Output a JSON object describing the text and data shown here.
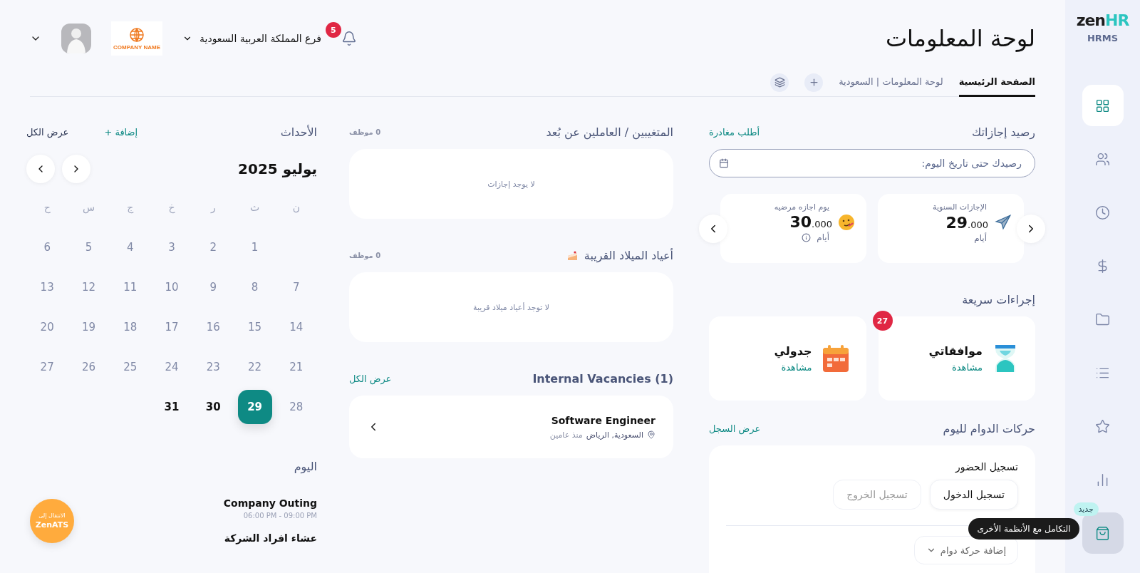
{
  "sidebar": {
    "brand": {
      "part_1": "zen",
      "part_2": "HR",
      "subtitle": "HRMS"
    },
    "items": [
      {
        "selected": true,
        "hovered": false
      },
      {
        "selected": false,
        "hovered": false
      },
      {
        "selected": false,
        "hovered": false
      },
      {
        "selected": false,
        "hovered": false
      },
      {
        "selected": false,
        "hovered": false
      },
      {
        "selected": false,
        "hovered": false
      },
      {
        "selected": false,
        "hovered": false
      },
      {
        "selected": false,
        "hovered": false
      },
      {
        "selected": false,
        "hovered": true,
        "badge": "جديد",
        "tooltip": "التكامل مع الأنظمة الأخرى"
      }
    ]
  },
  "header": {
    "title": "لوحة المعلومات",
    "notifications": "5",
    "branch": "فرع المملكة العربية السعودية",
    "company_logo_text": "COMPANY NAME"
  },
  "tabs": [
    {
      "label": "الصفحة الرئيسية",
      "selected": true
    },
    {
      "label": "لوحة المعلومات | السعودية",
      "selected": false
    }
  ],
  "leave_balance": {
    "title": "رصيد إجازاتك",
    "action": "أطلب مغادرة",
    "date_field": {
      "placeholder": "رصيدك حتى تاريخ اليوم:"
    },
    "cards": [
      {
        "label": "الإجازات السنوية",
        "value": "29.000",
        "unit": "أيام",
        "info": false
      },
      {
        "label": "يوم اجازه مرضيه",
        "value": "30.000",
        "unit": "أيام",
        "info": true
      }
    ]
  },
  "quick_actions": {
    "title": "إجراءات سريعة",
    "items": [
      {
        "title": "موافقاتي",
        "link": "مشاهدة",
        "badge": "27"
      },
      {
        "title": "جدولي",
        "link": "مشاهدة"
      }
    ]
  },
  "attendance": {
    "title": "حركات الدوام لليوم",
    "action": "عرض السجل",
    "heading": "تسجيل الحضور",
    "buttons": [
      {
        "label": "تسجيل الدخول",
        "disabled": false
      },
      {
        "label": "تسجيل الخروج",
        "disabled": true
      }
    ],
    "dropdown": "إضافة حركة دوام"
  },
  "absent": {
    "title": "المتغيبين / العاملين عن بُعد",
    "count": "0 موظف",
    "empty": "لا يوجد إجازات"
  },
  "birthdays": {
    "title": "أعياد الميلاد القريبة",
    "count": "0 موظف",
    "empty": "لا توجد أعياد ميلاد قريبة"
  },
  "vacancies": {
    "title": "Internal Vacancies (1)",
    "action": "عرض الكل",
    "items": [
      {
        "title": "Software Engineer",
        "location": "السعودية, الرياض",
        "age": "منذ عامين"
      }
    ]
  },
  "events": {
    "title": "الأحداث",
    "add": "إضافة +",
    "view_all": "عرض الكل",
    "month": "يوليو 2025",
    "weekdays": [
      "ن",
      "ث",
      "ر",
      "خ",
      "ج",
      "س",
      "ح"
    ],
    "days": [
      {
        "kind": "blank"
      },
      {
        "label": "1",
        "kind": "past",
        "selected": false
      },
      {
        "label": "2",
        "kind": "past",
        "selected": false
      },
      {
        "label": "3",
        "kind": "past",
        "selected": false
      },
      {
        "label": "4",
        "kind": "past",
        "selected": false
      },
      {
        "label": "5",
        "kind": "past",
        "selected": false
      },
      {
        "label": "6",
        "kind": "past",
        "selected": false
      },
      {
        "label": "7",
        "kind": "past",
        "selected": false
      },
      {
        "label": "8",
        "kind": "past",
        "selected": false
      },
      {
        "label": "9",
        "kind": "past",
        "selected": false
      },
      {
        "label": "10",
        "kind": "past",
        "selected": false
      },
      {
        "label": "11",
        "kind": "past",
        "selected": false
      },
      {
        "label": "12",
        "kind": "past",
        "selected": false
      },
      {
        "label": "13",
        "kind": "past",
        "selected": false
      },
      {
        "label": "14",
        "kind": "past",
        "selected": false
      },
      {
        "label": "15",
        "kind": "past",
        "selected": false
      },
      {
        "label": "16",
        "kind": "past",
        "selected": false
      },
      {
        "label": "17",
        "kind": "past",
        "selected": false
      },
      {
        "label": "18",
        "kind": "past",
        "selected": false
      },
      {
        "label": "19",
        "kind": "past",
        "selected": false
      },
      {
        "label": "20",
        "kind": "past",
        "selected": false
      },
      {
        "label": "21",
        "kind": "past",
        "selected": false
      },
      {
        "label": "22",
        "kind": "past",
        "selected": false
      },
      {
        "label": "23",
        "kind": "past",
        "selected": false
      },
      {
        "label": "24",
        "kind": "past",
        "selected": false
      },
      {
        "label": "25",
        "kind": "past",
        "selected": false
      },
      {
        "label": "26",
        "kind": "past",
        "selected": false
      },
      {
        "label": "27",
        "kind": "past",
        "selected": false
      },
      {
        "label": "28",
        "kind": "past",
        "selected": false
      },
      {
        "label": "29",
        "kind": "today",
        "selected": true
      },
      {
        "label": "30",
        "kind": "upcoming",
        "selected": false
      },
      {
        "label": "31",
        "kind": "upcoming",
        "selected": false
      }
    ],
    "today_title": "اليوم",
    "today_items": [
      {
        "title": "Company Outing",
        "time": "06:00 PM - 09:00 PM"
      },
      {
        "title": "عشاء افراد الشركة"
      }
    ]
  },
  "ats_button": {
    "line_1": "الانتقال إلى",
    "line_2": "ZenATS"
  }
}
